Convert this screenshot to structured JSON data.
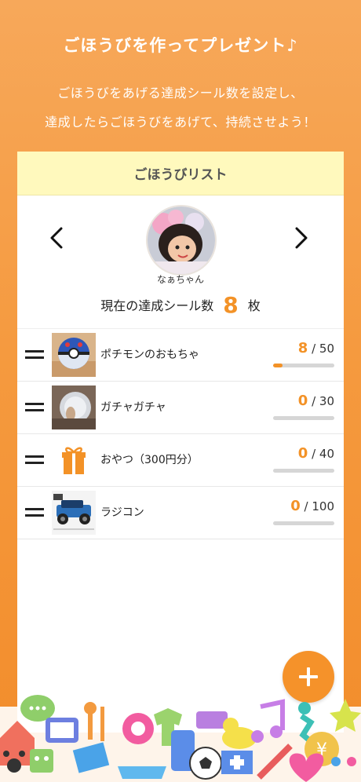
{
  "header": {
    "title": "ごほうびを作ってプレゼント♪",
    "sub_line1": "ごほうびをあげる達成シール数を設定し、",
    "sub_line2": "達成したらごほうびをあげて、持続させよう！"
  },
  "card": {
    "title": "ごほうびリスト",
    "child_name": "なぁちゃん",
    "count_prefix": "現在の達成シール数",
    "count_value": "8",
    "count_unit": "枚"
  },
  "rewards": [
    {
      "name": "ポチモンのおもちゃ",
      "current": "8",
      "total": "/ 50",
      "progress": 0.16
    },
    {
      "name": "ガチャガチャ",
      "current": "0",
      "total": "/ 30",
      "progress": 0
    },
    {
      "name": "おやつ（300円分）",
      "current": "0",
      "total": "/ 40",
      "progress": 0
    },
    {
      "name": "ラジコン",
      "current": "0",
      "total": "/ 100",
      "progress": 0
    }
  ],
  "colors": {
    "accent": "#f39227",
    "card_head": "#fff9bd"
  },
  "icons": [
    "chevron-left-icon",
    "chevron-right-icon",
    "drag-handle-icon",
    "gift-icon",
    "plus-icon"
  ]
}
